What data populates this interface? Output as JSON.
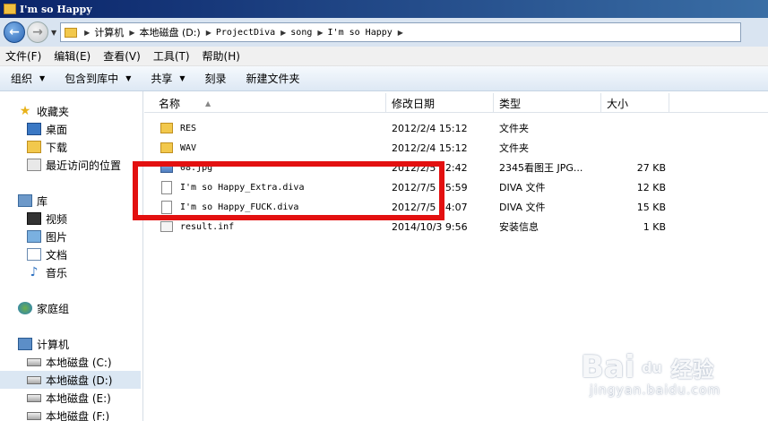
{
  "window": {
    "title": "I'm so Happy"
  },
  "address": {
    "crumbs": [
      "计算机",
      "本地磁盘 (D:)",
      "ProjectDiva",
      "song",
      "I'm so Happy"
    ]
  },
  "menu": [
    "文件(F)",
    "编辑(E)",
    "查看(V)",
    "工具(T)",
    "帮助(H)"
  ],
  "toolbar": {
    "organize": "组织",
    "include": "包含到库中",
    "share": "共享",
    "burn": "刻录",
    "new_folder": "新建文件夹"
  },
  "nav": {
    "favorites": "收藏夹",
    "desktop": "桌面",
    "downloads": "下载",
    "recent": "最近访问的位置",
    "libraries": "库",
    "videos": "视频",
    "pictures": "图片",
    "documents": "文档",
    "music": "音乐",
    "homegroup": "家庭组",
    "computer": "计算机",
    "drives": [
      "本地磁盘 (C:)",
      "本地磁盘 (D:)",
      "本地磁盘 (E:)",
      "本地磁盘 (F:)"
    ]
  },
  "columns": {
    "name": "名称",
    "modified": "修改日期",
    "type": "类型",
    "size": "大小"
  },
  "files": [
    {
      "name": "RES",
      "modified": "2012/2/4 15:12",
      "type": "文件夹",
      "size": "",
      "icon": "folder-icon"
    },
    {
      "name": "WAV",
      "modified": "2012/2/4 15:12",
      "type": "文件夹",
      "size": "",
      "icon": "folder-icon"
    },
    {
      "name": "08.jpg",
      "modified": "2012/2/5 22:42",
      "type": "2345看图王 JPG...",
      "size": "27 KB",
      "icon": "jpg-file-icon"
    },
    {
      "name": "I'm so Happy_Extra.diva",
      "modified": "2012/7/5 15:59",
      "type": "DIVA 文件",
      "size": "12 KB",
      "icon": "file-icon"
    },
    {
      "name": "I'm so Happy_FUCK.diva",
      "modified": "2012/7/5 14:07",
      "type": "DIVA 文件",
      "size": "15 KB",
      "icon": "file-icon"
    },
    {
      "name": "result.inf",
      "modified": "2014/10/3 9:56",
      "type": "安装信息",
      "size": "1 KB",
      "icon": "inf-file-icon"
    }
  ],
  "watermark": {
    "brand": "Bai",
    "brand2": "经验",
    "url": "jingyan.baidu.com"
  }
}
